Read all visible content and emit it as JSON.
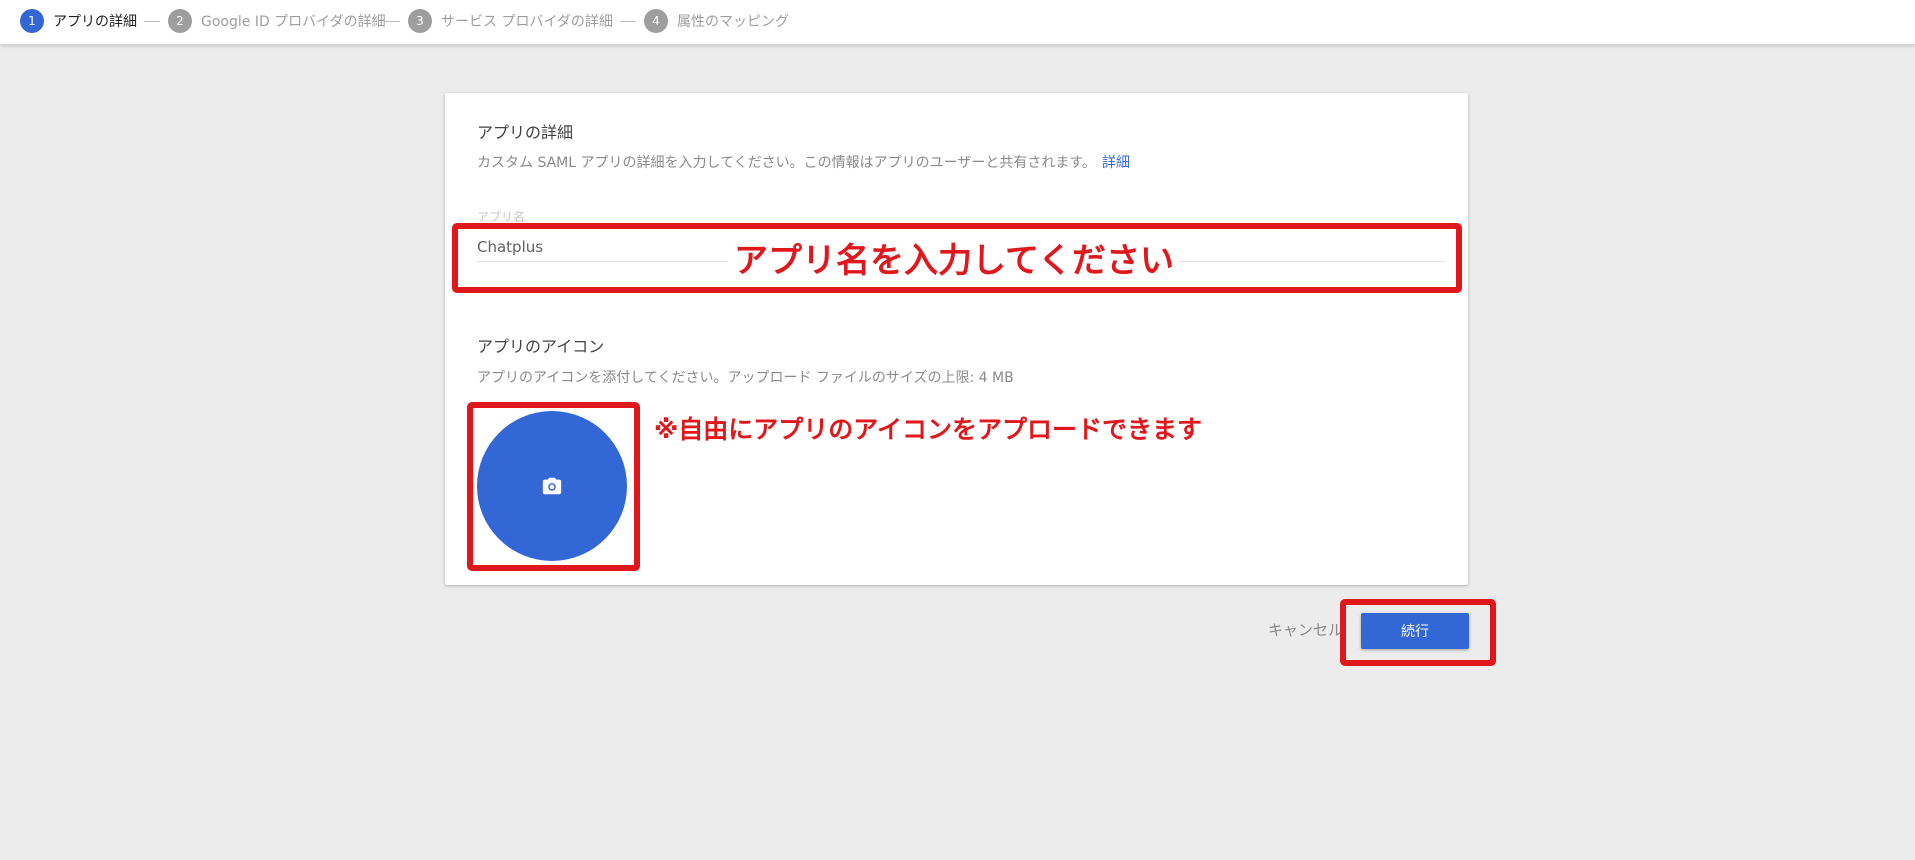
{
  "stepper": {
    "steps": [
      {
        "number": "1",
        "label": "アプリの詳細",
        "active": true
      },
      {
        "number": "2",
        "label": "Google ID プロバイダの詳細",
        "active": false
      },
      {
        "number": "3",
        "label": "サービス プロバイダの詳細",
        "active": false
      },
      {
        "number": "4",
        "label": "属性のマッピング",
        "active": false
      }
    ]
  },
  "app_details": {
    "title": "アプリの詳細",
    "description": "カスタム SAML アプリの詳細を入力してください。この情報はアプリのユーザーと共有されます。",
    "details_link": "詳細",
    "name_label": "アプリ名",
    "name_value": "Chatplus"
  },
  "app_icon": {
    "title": "アプリのアイコン",
    "description": "アプリのアイコンを添付してください。アップロード ファイルのサイズの上限: 4 MB",
    "icon": "camera-icon"
  },
  "annotations": {
    "name_hint": "アプリ名を入力してください",
    "icon_hint": "※自由にアプリのアイコンをアプロードできます"
  },
  "footer": {
    "cancel_label": "キャンセル",
    "continue_label": "続行"
  },
  "colors": {
    "accent": "#3367d6",
    "annotation": "#e0171b",
    "background": "#ececec"
  }
}
